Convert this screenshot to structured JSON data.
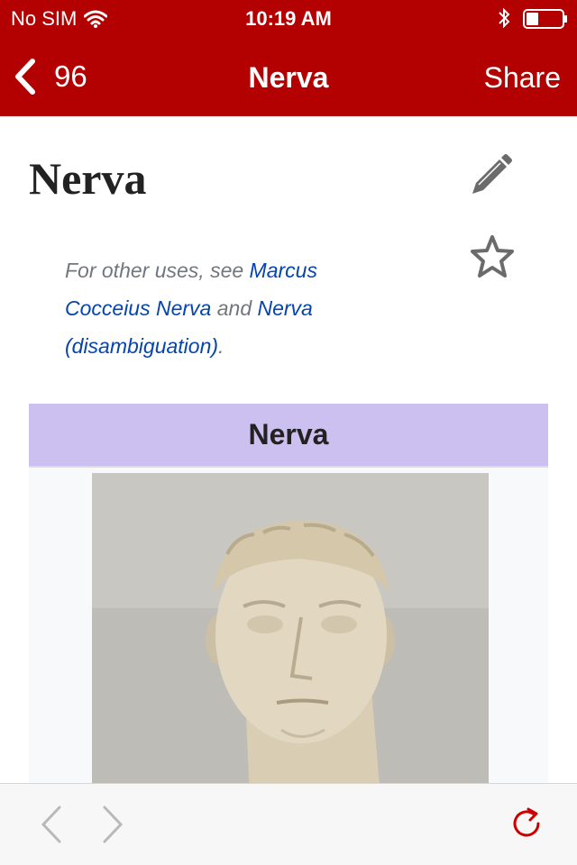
{
  "status_bar": {
    "carrier": "No SIM",
    "time": "10:19 AM",
    "battery_level_percent": 30
  },
  "nav_bar": {
    "back_count": "96",
    "title": "Nerva",
    "share_label": "Share",
    "background_color": "#b30000"
  },
  "article": {
    "title": "Nerva",
    "hatnote": {
      "prefix": "For other uses, see ",
      "link1": "Marcus Cocceius Nerva",
      "middle": " and ",
      "link2": "Nerva (disambiguation)",
      "suffix": "."
    },
    "infobox": {
      "header": "Nerva",
      "header_color": "#ccc0f0"
    }
  },
  "icons": {
    "edit": "pencil-icon",
    "save": "star-icon",
    "back": "chevron-left-icon",
    "forward": "chevron-right-icon",
    "reload": "reload-icon"
  },
  "toolbar": {
    "accent_color": "#cc0000"
  }
}
